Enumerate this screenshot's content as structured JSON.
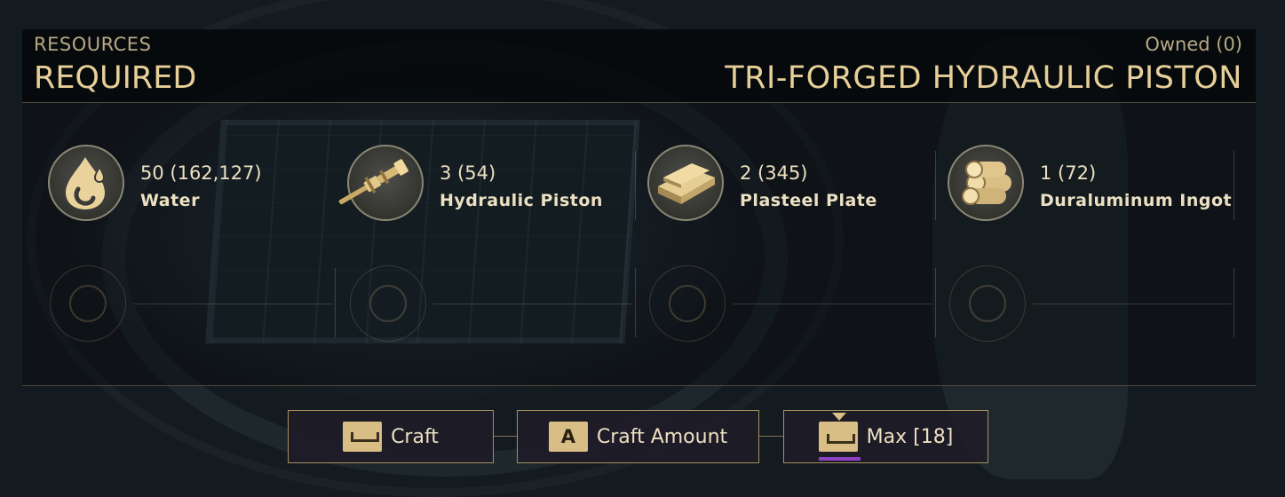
{
  "header": {
    "section_label": "RESOURCES",
    "section_title": "REQUIRED",
    "owned": "Owned (0)",
    "item_title": "TRI-FORGED HYDRAULIC PISTON"
  },
  "resources": [
    {
      "quantity": "50 (162,127)",
      "name": "Water",
      "icon": "water-drop-icon"
    },
    {
      "quantity": "3 (54)",
      "name": "Hydraulic Piston",
      "icon": "hydraulic-piston-icon"
    },
    {
      "quantity": "2 (345)",
      "name": "Plasteel Plate",
      "icon": "plasteel-plate-icon"
    },
    {
      "quantity": "1 (72)",
      "name": "Duraluminum Ingot",
      "icon": "duraluminum-ingot-icon"
    }
  ],
  "actions": {
    "craft_label": "Craft",
    "craft_amount_key": "A",
    "craft_amount_label": "Craft Amount",
    "max_label": "Max [18]"
  },
  "colors": {
    "accent_gold": "#e7cf98",
    "border_gold": "#a4915f",
    "highlight_purple": "#8e3fc4"
  }
}
